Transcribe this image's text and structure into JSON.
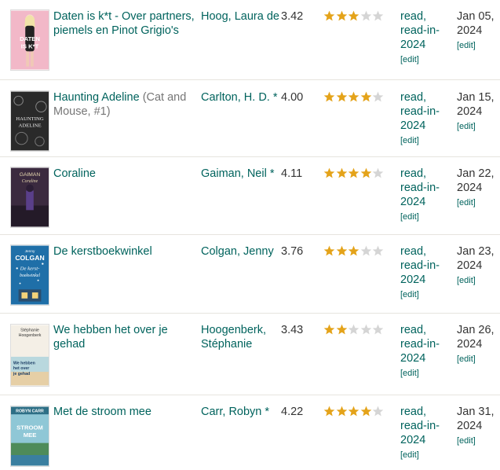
{
  "rows": [
    {
      "title": "Daten is k*t - Over partners, piemels en Pinot Grigio's",
      "series": "",
      "author": "Hoog, Laura de",
      "avg_rating": "3.42",
      "stars": 3,
      "shelves": "read, read-in-2024",
      "shelves_edit": "[edit]",
      "date": "Jan 05, 2024",
      "date_edit": "[edit]",
      "cover_text": [
        "DATEN",
        "IS K*T"
      ],
      "cover_color": "#f2b8c8"
    },
    {
      "title": "Haunting Adeline",
      "series": "(Cat and Mouse, #1)",
      "author": "Carlton, H. D. *",
      "avg_rating": "4.00",
      "stars": 4,
      "shelves": "read, read-in-2024",
      "shelves_edit": "[edit]",
      "date": "Jan 15, 2024",
      "date_edit": "[edit]",
      "cover_text": [
        "HAUNTING",
        "ADELINE"
      ],
      "cover_color": "#2a2a2a"
    },
    {
      "title": "Coraline",
      "series": "",
      "author": "Gaiman, Neil *",
      "avg_rating": "4.11",
      "stars": 4,
      "shelves": "read, read-in-2024",
      "shelves_edit": "[edit]",
      "date": "Jan 22, 2024",
      "date_edit": "[edit]",
      "cover_text": [
        "GAIMAN",
        "Coraline"
      ],
      "cover_color": "#3b2a3f"
    },
    {
      "title": "De kerstboekwinkel",
      "series": "",
      "author": "Colgan, Jenny",
      "avg_rating": "3.76",
      "stars": 3,
      "shelves": "read, read-in-2024",
      "shelves_edit": "[edit]",
      "date": "Jan 23, 2024",
      "date_edit": "[edit]",
      "cover_text": [
        "Jenny",
        "COLGAN",
        "De kerst-",
        "boekwinkel"
      ],
      "cover_color": "#1f6fa8"
    },
    {
      "title": "We hebben het over je gehad",
      "series": "",
      "author": "Hoogenberk, Stéphanie",
      "avg_rating": "3.43",
      "stars": 2,
      "shelves": "read, read-in-2024",
      "shelves_edit": "[edit]",
      "date": "Jan 26, 2024",
      "date_edit": "[edit]",
      "cover_text": [
        "Stéphanie",
        "Hoogenberk",
        "We hebben",
        "het over",
        "je gehad"
      ],
      "cover_color": "#f4efe6"
    },
    {
      "title": "Met de stroom mee",
      "series": "",
      "author": "Carr, Robyn *",
      "avg_rating": "4.22",
      "stars": 4,
      "shelves": "read, read-in-2024",
      "shelves_edit": "[edit]",
      "date": "Jan 31, 2024",
      "date_edit": "[edit]",
      "cover_text": [
        "ROBYN CARR",
        "STROOM",
        "MEE"
      ],
      "cover_color": "#5fa7b8"
    }
  ],
  "colors": {
    "link": "#00635d",
    "star_on": "#e4a31a",
    "star_off": "#d5d5d5",
    "divider": "#e6e4de"
  }
}
